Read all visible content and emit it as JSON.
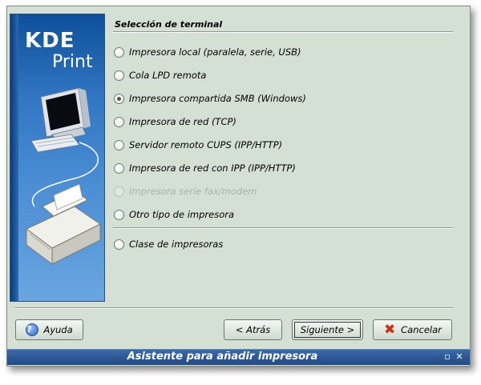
{
  "window": {
    "title": "Asistente para añadir impresora"
  },
  "banner": {
    "logo_line1": "KDE",
    "logo_line2": "Print"
  },
  "section": {
    "title": "Selección de terminal"
  },
  "options": [
    {
      "label": "Impresora local (paralela, serie, USB)",
      "checked": false,
      "enabled": true
    },
    {
      "label": "Cola LPD remota",
      "checked": false,
      "enabled": true
    },
    {
      "label": "Impresora compartida SMB (Windows)",
      "checked": true,
      "enabled": true
    },
    {
      "label": "Impresora de red (TCP)",
      "checked": false,
      "enabled": true
    },
    {
      "label": "Servidor remoto CUPS (IPP/HTTP)",
      "checked": false,
      "enabled": true
    },
    {
      "label": "Impresora de red con IPP (IPP/HTTP)",
      "checked": false,
      "enabled": true
    },
    {
      "label": "Impresora serie fax/modem",
      "checked": false,
      "enabled": false
    },
    {
      "label": "Otro tipo de impresora",
      "checked": false,
      "enabled": true
    },
    {
      "label": "Clase de impresoras",
      "checked": false,
      "enabled": true
    }
  ],
  "buttons": {
    "help": "Ayuda",
    "back": "< Atrás",
    "next": "Siguiente >",
    "cancel": "Cancelar"
  },
  "icons": {
    "help": "help-icon",
    "cancel": "cancel-x-icon",
    "window_restore": "window-restore-icon",
    "window_close": "window-close-icon"
  },
  "colors": {
    "dialog_bg": "#d5e0d5",
    "titlebar": "#2d5896",
    "banner": "#3277c4"
  }
}
